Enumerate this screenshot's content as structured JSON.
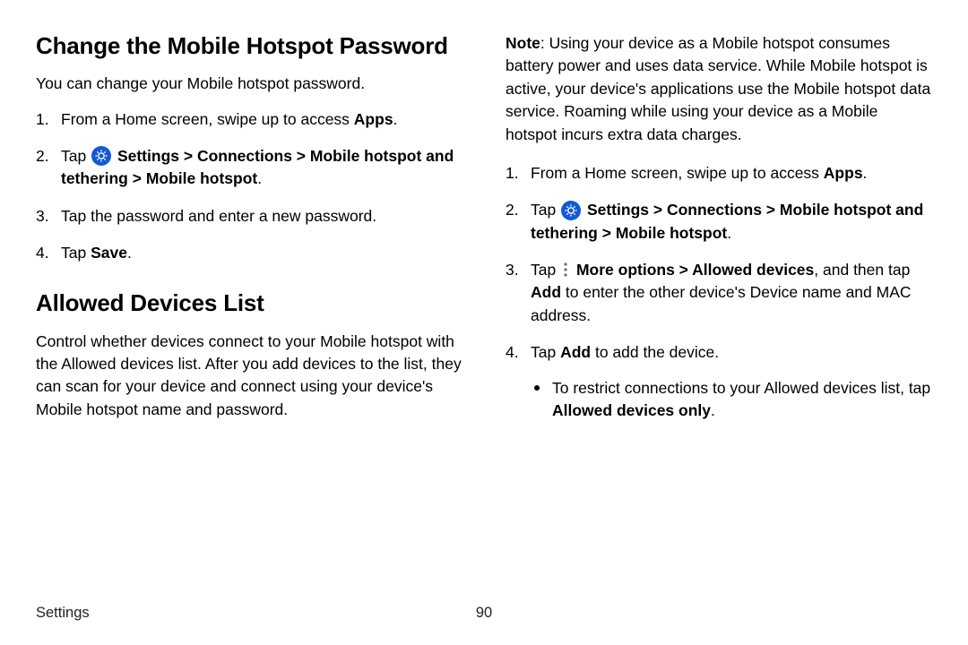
{
  "left": {
    "heading1": "Change the Mobile Hotspot Password",
    "intro1": "You can change your Mobile hotspot password.",
    "steps1": {
      "s1_pre": "From a Home screen, swipe up to access ",
      "s1_b": "Apps",
      "s1_post": ".",
      "s2_pre": "Tap ",
      "s2_b1": "Settings",
      "s2_sep": " > ",
      "s2_b2": "Connections",
      "s2_b3": "Mobile hotspot and tethering",
      "s2_b4": "Mobile hotspot",
      "s2_post": ".",
      "s3": "Tap the password and enter a new password.",
      "s4_pre": "Tap ",
      "s4_b": "Save",
      "s4_post": "."
    },
    "heading2": "Allowed Devices List",
    "intro2": "Control whether devices connect to your Mobile hotspot with the Allowed devices list. After you add devices to the list, they can scan for your device and connect using your device's Mobile hotspot name and password."
  },
  "right": {
    "note_label": "Note",
    "note_text": ": Using your device as a Mobile hotspot consumes battery power and uses data service. While Mobile hotspot is active, your device's applications use the Mobile hotspot data service. Roaming while using your device as a Mobile hotspot incurs extra data charges.",
    "steps": {
      "s1_pre": "From a Home screen, swipe up to access ",
      "s1_b": "Apps",
      "s1_post": ".",
      "s2_pre": "Tap ",
      "s2_b1": "Settings",
      "s2_sep": " > ",
      "s2_b2": "Connections",
      "s2_b3": "Mobile hotspot and tethering",
      "s2_b4": "Mobile hotspot",
      "s2_post": ".",
      "s3_pre": "Tap ",
      "s3_b1": "More options",
      "s3_mid1": " > ",
      "s3_b2": "Allowed devices",
      "s3_mid2": ", and then tap ",
      "s3_b3": "Add",
      "s3_post": " to enter the other device's Device name and MAC address.",
      "s4_pre": "Tap ",
      "s4_b": "Add",
      "s4_post": " to add the device.",
      "bullet_pre": "To restrict connections to your Allowed devices list, tap ",
      "bullet_b": "Allowed devices only",
      "bullet_post": "."
    }
  },
  "footer": {
    "section": "Settings",
    "page": "90"
  }
}
